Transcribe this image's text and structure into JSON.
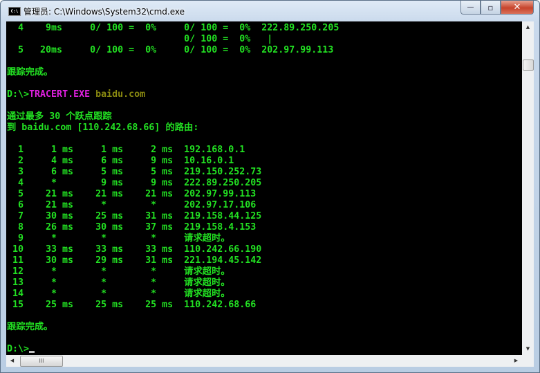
{
  "window": {
    "title": "管理员: C:\\Windows\\System32\\cmd.exe",
    "icon_label": "C:\\",
    "controls": {
      "minimize": "—",
      "maximize": "▫",
      "close": "✕"
    }
  },
  "colors": {
    "green": "#22e022",
    "magenta": "#e020e0",
    "olive": "#8a8a10",
    "background": "#000000"
  },
  "console": {
    "lines": [
      [
        {
          "t": "  4    9ms     0/ 100 =  0%     0/ 100 =  0%  222.89.250.205",
          "c": "green"
        }
      ],
      [
        {
          "t": "                                0/ 100 =  0%   |",
          "c": "green"
        }
      ],
      [
        {
          "t": "  5   20ms     0/ 100 =  0%     0/ 100 =  0%  202.97.99.113",
          "c": "green"
        }
      ],
      [],
      [
        {
          "t": "跟踪完成。",
          "c": "green"
        }
      ],
      [],
      [
        {
          "t": "D:\\>",
          "c": "green"
        },
        {
          "t": "TRACERT.EXE",
          "c": "magenta"
        },
        {
          "t": " baidu.com",
          "c": "olive"
        }
      ],
      [],
      [
        {
          "t": "通过最多 30 个跃点跟踪",
          "c": "green"
        }
      ],
      [
        {
          "t": "到 baidu.com [110.242.68.66] 的路由:",
          "c": "green"
        }
      ],
      [],
      [
        {
          "t": "  1     1 ms     1 ms     2 ms  192.168.0.1",
          "c": "green"
        }
      ],
      [
        {
          "t": "  2     4 ms     6 ms     9 ms  10.16.0.1",
          "c": "green"
        }
      ],
      [
        {
          "t": "  3     6 ms     5 ms     5 ms  219.150.252.73",
          "c": "green"
        }
      ],
      [
        {
          "t": "  4     *        9 ms     9 ms  222.89.250.205",
          "c": "green"
        }
      ],
      [
        {
          "t": "  5    21 ms    21 ms    21 ms  202.97.99.113",
          "c": "green"
        }
      ],
      [
        {
          "t": "  6    21 ms     *        *     202.97.17.106",
          "c": "green"
        }
      ],
      [
        {
          "t": "  7    30 ms    25 ms    31 ms  219.158.44.125",
          "c": "green"
        }
      ],
      [
        {
          "t": "  8    26 ms    30 ms    37 ms  219.158.4.153",
          "c": "green"
        }
      ],
      [
        {
          "t": "  9     *        *        *     请求超时。",
          "c": "green"
        }
      ],
      [
        {
          "t": " 10    33 ms    33 ms    33 ms  110.242.66.190",
          "c": "green"
        }
      ],
      [
        {
          "t": " 11    30 ms    29 ms    31 ms  221.194.45.142",
          "c": "green"
        }
      ],
      [
        {
          "t": " 12     *        *        *     请求超时。",
          "c": "green"
        }
      ],
      [
        {
          "t": " 13     *        *        *     请求超时。",
          "c": "green"
        }
      ],
      [
        {
          "t": " 14     *        *        *     请求超时。",
          "c": "green"
        }
      ],
      [
        {
          "t": " 15    25 ms    25 ms    25 ms  110.242.68.66",
          "c": "green"
        }
      ],
      [],
      [
        {
          "t": "跟踪完成。",
          "c": "green"
        }
      ],
      [],
      [
        {
          "t": "D:\\>",
          "c": "green"
        }
      ]
    ]
  },
  "scrollbars": {
    "vertical_up": "▲",
    "vertical_down": "▼",
    "horizontal_left": "◀",
    "horizontal_right": "▶",
    "thumb_grip": "III"
  }
}
